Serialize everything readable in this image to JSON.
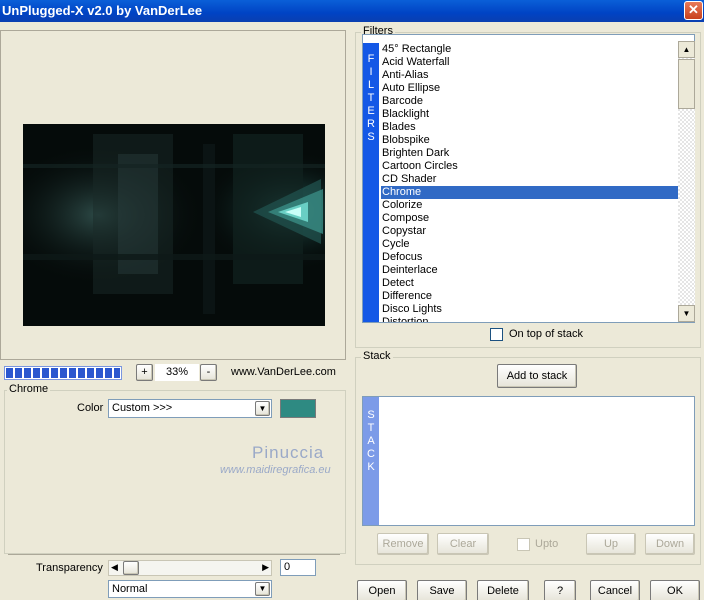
{
  "window": {
    "title": "UnPlugged-X v2.0 by VanDerLee",
    "close_glyph": "✕"
  },
  "preview": {
    "zoom_out": "-",
    "zoom_in": "+",
    "zoom_level": "33%",
    "website": "www.VanDerLee.com",
    "progress": 1.0
  },
  "settings": {
    "group_label": "Chrome",
    "color_label": "Color",
    "color_value": "Custom >>>",
    "swatch_color": "#2e8a82",
    "transparency_label": "Transparency",
    "transparency_value": "0",
    "blend_value": "Normal"
  },
  "watermark": {
    "line1": "Pinuccia",
    "line2": "www.maidiregrafica.eu"
  },
  "filters": {
    "group_label": "Filters",
    "strip_letters": [
      "F",
      "I",
      "L",
      "T",
      "E",
      "R",
      "S"
    ],
    "items": [
      "45° Rectangle",
      "Acid Waterfall",
      "Anti-Alias",
      "Auto Ellipse",
      "Barcode",
      "Blacklight",
      "Blades",
      "Blobspike",
      "Brighten Dark",
      "Cartoon Circles",
      "CD Shader",
      "Chrome",
      "Colorize",
      "Compose",
      "Copystar",
      "Cycle",
      "Defocus",
      "Deinterlace",
      "Detect",
      "Difference",
      "Disco Lights",
      "Distortion"
    ],
    "selected_index": 11,
    "on_top_label": "On top of stack"
  },
  "stack": {
    "group_label": "Stack",
    "add_button": "Add to stack",
    "strip_letters": [
      "S",
      "T",
      "A",
      "C",
      "K"
    ],
    "remove_button": "Remove",
    "clear_button": "Clear",
    "upto_label": "Upto",
    "up_button": "Up",
    "down_button": "Down"
  },
  "footer": {
    "open": "Open",
    "save": "Save",
    "delete": "Delete",
    "help": "?",
    "cancel": "Cancel",
    "ok": "OK"
  }
}
